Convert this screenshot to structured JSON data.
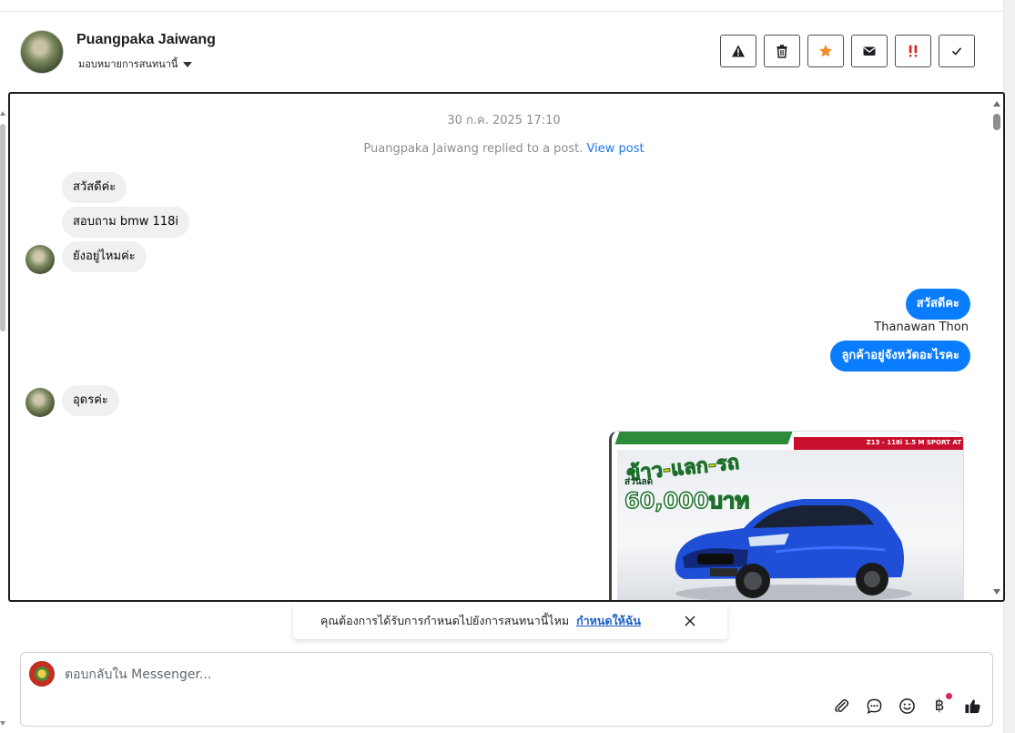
{
  "conversation": {
    "contact_name": "Puangpaka Jaiwang",
    "assign_label": "มอบหมายการสนทนานี้"
  },
  "actions": [
    {
      "name": "report-button",
      "icon": "warning-icon"
    },
    {
      "name": "delete-button",
      "icon": "trash-icon"
    },
    {
      "name": "star-button",
      "icon": "star-icon"
    },
    {
      "name": "mark-unread-button",
      "icon": "envelope-icon"
    },
    {
      "name": "follow-up-button",
      "icon": "double-exclamation-icon"
    },
    {
      "name": "mark-done-button",
      "icon": "check-icon"
    }
  ],
  "chat": {
    "timestamp": "30 ก.ค. 2025 17:10",
    "replied_text": "Puangpaka Jaiwang replied to a post.",
    "view_post_link": "View post",
    "messages": [
      {
        "direction": "in",
        "text": "สวัสดีค่ะ"
      },
      {
        "direction": "in",
        "text": "สอบถาม bmw 118i"
      },
      {
        "direction": "in",
        "text": "ยังอยู่ไหมค่ะ"
      },
      {
        "direction": "out",
        "text": "สวัสดีคะ"
      },
      {
        "direction": "out",
        "sender": "Thanawan Thon",
        "text": "ลูกค้าอยู่จังหวัดอะไรคะ"
      },
      {
        "direction": "in",
        "text": "อุดรค่ะ"
      }
    ],
    "image_card": {
      "promo_line1": "ข้าว-แลก-รถ",
      "promo_line2": "ส่วนลด",
      "promo_line3": "60,000บาท",
      "banner_right": "Z13 - 118i 1.5 M SPORT AT"
    }
  },
  "toast": {
    "question": "คุณต้องการได้รับการกำหนดไปยังการสนทนานี้ไหม",
    "assign_me": "กำหนดให้ฉัน"
  },
  "composer": {
    "placeholder": "ตอบกลับใน Messenger...",
    "tools": [
      "attachment-icon",
      "saved-replies-icon",
      "emoji-icon",
      "baht-payment-icon",
      "thumbs-up-icon"
    ],
    "payment_symbol": "฿"
  },
  "colors": {
    "outgoing_bubble": "#0a7cff",
    "incoming_bubble": "#f0f0f0",
    "link": "#1877f2",
    "star": "#f28c28",
    "alert": "#e02020"
  }
}
